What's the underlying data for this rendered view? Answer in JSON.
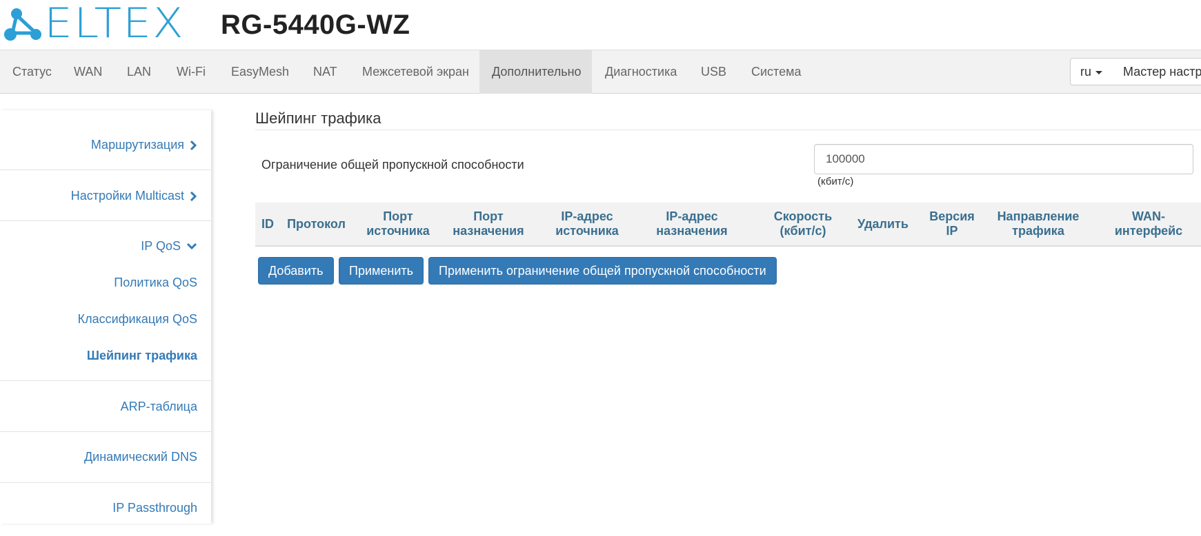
{
  "header": {
    "logo_text": "ELTEX",
    "model": "RG-5440G-WZ"
  },
  "nav": {
    "items": [
      {
        "label": "Статус",
        "active": false
      },
      {
        "label": "WAN",
        "active": false
      },
      {
        "label": "LAN",
        "active": false
      },
      {
        "label": "Wi-Fi",
        "active": false
      },
      {
        "label": "EasyMesh",
        "active": false
      },
      {
        "label": "NAT",
        "active": false
      },
      {
        "label": "Межсетевой экран",
        "active": false
      },
      {
        "label": "Дополнительно",
        "active": true
      },
      {
        "label": "Диагностика",
        "active": false
      },
      {
        "label": "USB",
        "active": false
      },
      {
        "label": "Система",
        "active": false
      }
    ],
    "language": "ru",
    "wizard_label": "Мастер настройки"
  },
  "sidebar": {
    "items": [
      {
        "label": "Маршрутизация",
        "icon": "chevron-right-icon"
      },
      {
        "label": "Настройки Multicast",
        "icon": "chevron-right-icon"
      },
      {
        "label": "IP QoS",
        "icon": "chevron-down-icon"
      },
      {
        "label": "Политика QoS"
      },
      {
        "label": "Классификация QoS"
      },
      {
        "label": "Шейпинг трафика",
        "selected": true
      },
      {
        "label": "ARP-таблица"
      },
      {
        "label": "Динамический DNS"
      },
      {
        "label": "IP Passthrough"
      }
    ]
  },
  "main": {
    "title": "Шейпинг трафика",
    "limit_label": "Ограничение общей пропускной способности",
    "limit_value": "100000",
    "limit_unit": "(кбит/с)",
    "table_headers": [
      "ID",
      "Протокол",
      "Порт источника",
      "Порт назначения",
      "IP-адрес источника",
      "IP-адрес назначения",
      "Скорость (кбит/с)",
      "Удалить",
      "Версия IP",
      "Направление трафика",
      "WAN-интерфейс"
    ],
    "buttons": {
      "add": "Добавить",
      "apply": "Применить",
      "apply_limit": "Применить ограничение общей пропускной способности"
    }
  },
  "colors": {
    "brand": "#2c9fd6",
    "link": "#337ab7",
    "primary_button": "#337ab7",
    "table_header_text": "#3a6f8f"
  }
}
